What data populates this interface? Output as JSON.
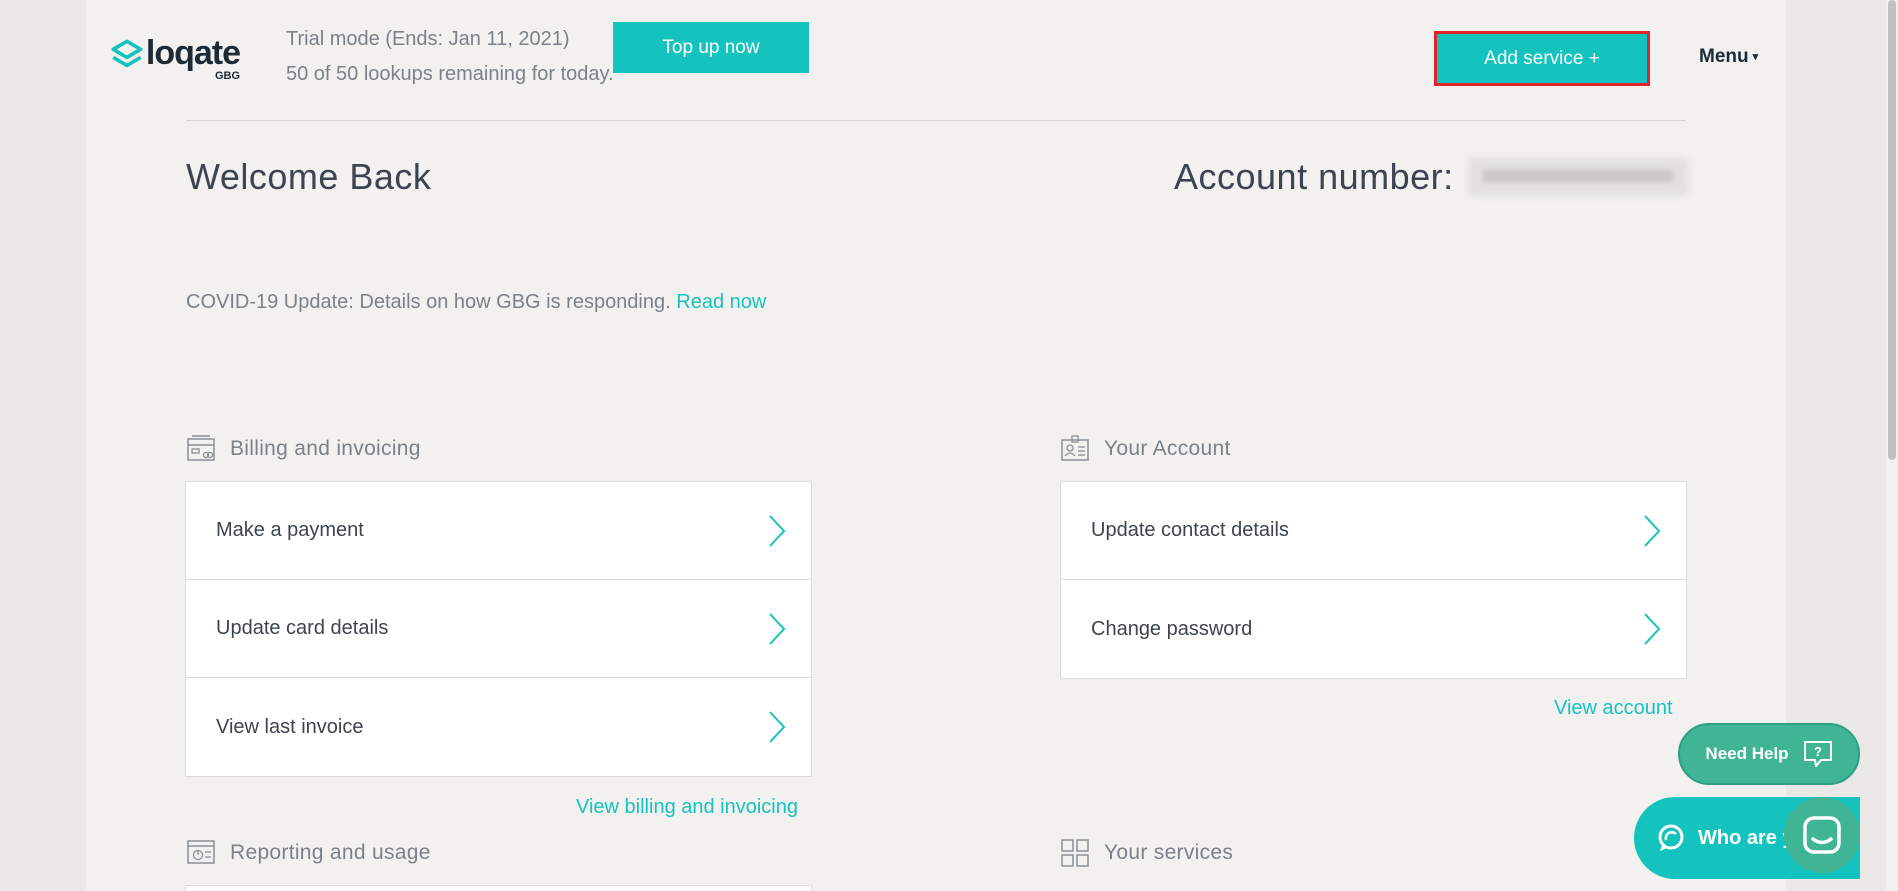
{
  "header": {
    "logo_text": "loqate",
    "logo_sub": "GBG",
    "trial_text": "Trial mode (Ends: Jan 11, 2021)",
    "lookups_text": "50 of 50 lookups remaining for today.",
    "topup_label": "Top up now",
    "add_service_label": "Add service +",
    "menu_label": "Menu",
    "menu_caret": "▾"
  },
  "welcome": {
    "title": "Welcome Back",
    "account_label": "Account number:"
  },
  "covid": {
    "text": "COVID-19 Update: Details on how GBG is responding.",
    "link": "Read now"
  },
  "billing": {
    "title": "Billing and invoicing",
    "items": [
      {
        "label": "Make a payment"
      },
      {
        "label": "Update card details"
      },
      {
        "label": "View last invoice"
      }
    ],
    "link": "View billing and invoicing"
  },
  "account": {
    "title": "Your Account",
    "items": [
      {
        "label": "Update contact details"
      },
      {
        "label": "Change password"
      }
    ],
    "link": "View account"
  },
  "reporting": {
    "title": "Reporting and usage"
  },
  "services": {
    "title": "Your services"
  },
  "help": {
    "need_help_label": "Need Help",
    "who_are_label": "Who are y"
  },
  "colors": {
    "accent": "#15c3be",
    "help_green": "#3fb596",
    "highlight_border": "#e0242b",
    "background": "#f2f1ef"
  },
  "icons": {
    "billing": "billing-card-icon",
    "account": "id-card-icon",
    "reporting": "report-window-icon",
    "services": "grid-icon",
    "chevron": "chevron-right-icon",
    "help": "question-bubble-icon",
    "chat": "chat-icon"
  }
}
